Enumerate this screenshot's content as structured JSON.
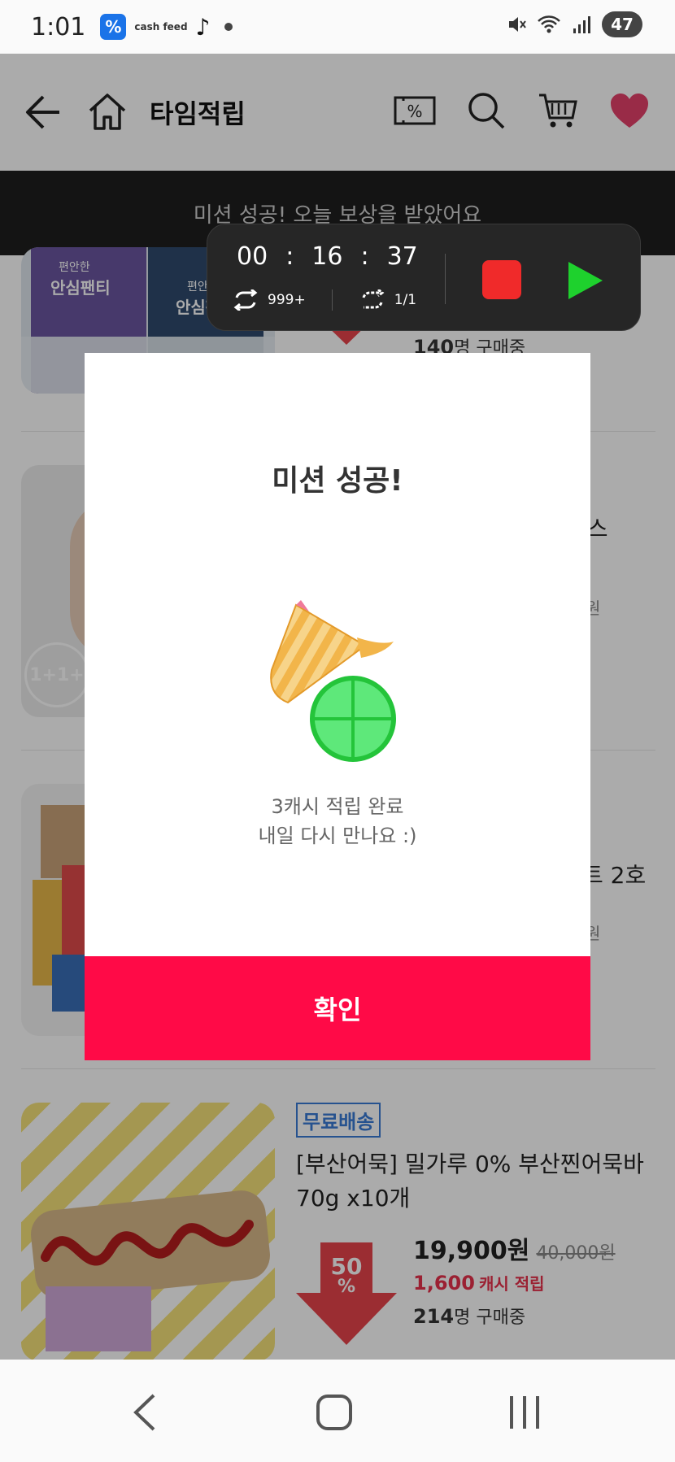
{
  "status_bar": {
    "time": "1:01",
    "app_cash_label": "cash feed",
    "battery": "47"
  },
  "header": {
    "title": "타임적립",
    "icons": [
      "back-arrow-icon",
      "home-icon",
      "coupon-icon",
      "search-icon",
      "cart-icon",
      "heart-icon"
    ]
  },
  "notice": {
    "text": "미션 성공! 오늘 보상을 받았어요"
  },
  "products": [
    {
      "thumb_labels": [
        "편안한",
        "안심팬티",
        "편안한",
        "안심팬"
      ],
      "buyers_count": "140",
      "buyers_suffix": "명 구매중"
    },
    {
      "name_fragment": "이스",
      "price_fragment": "원",
      "badge": "1+1+"
    },
    {
      "name_fragment": "트 2호",
      "price_fragment": "원"
    },
    {
      "tag": "무료배송",
      "name": "[부산어묵] 밀가루 0% 부산찐어묵바 70g x10개",
      "price": "19,900원",
      "original_price": "40,000원",
      "cash": "1,600",
      "cash_suffix": "캐시 적립",
      "buyers_count": "214",
      "buyers_suffix": "명 구매중",
      "discount_number": "50",
      "discount_unit": "%"
    }
  ],
  "recorder": {
    "hours": "00",
    "minutes": "16",
    "seconds": "37",
    "loop_count": "999+",
    "repeat_count": "1/1"
  },
  "modal": {
    "title": "미션 성공!",
    "message_line1": "3캐시 적립 완료",
    "message_line2": "내일 다시 만나요 :)",
    "confirm_label": "확인"
  },
  "colors": {
    "accent": "#ff0a47",
    "cash_red": "#e8314b",
    "free_ship_blue": "#3a7bd5",
    "recorder_bg": "#262626"
  }
}
